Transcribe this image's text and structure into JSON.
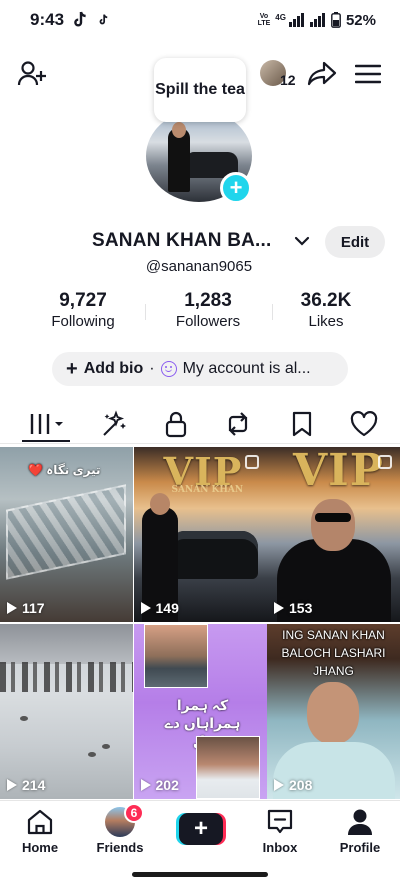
{
  "status_bar": {
    "time": "9:43",
    "volte_label": "Vo\nLTE",
    "network": "4G",
    "battery": "52%"
  },
  "header": {
    "add_friend_icon": "add-person-icon",
    "visitor_count": "12",
    "share_icon": "share-arrow-icon",
    "menu_icon": "hamburger-menu-icon"
  },
  "profile": {
    "note_bubble": "Spill the tea",
    "display_name": "SANAN KHAN BA...",
    "handle": "@sananan9065",
    "edit_label": "Edit",
    "add_avatar_plus": "+"
  },
  "stats": [
    {
      "value": "9,727",
      "label": "Following"
    },
    {
      "value": "1,283",
      "label": "Followers"
    },
    {
      "value": "36.2K",
      "label": "Likes"
    }
  ],
  "bio": {
    "add_bio_label": "Add bio",
    "separator": "·",
    "account_label": "My account is al..."
  },
  "tabs": [
    {
      "name": "videos",
      "icon": "grid-bars-icon",
      "active": true
    },
    {
      "name": "sparkle",
      "icon": "sparkle-magic-icon"
    },
    {
      "name": "private",
      "icon": "lock-icon"
    },
    {
      "name": "reposts",
      "icon": "repost-icon"
    },
    {
      "name": "favorites",
      "icon": "bookmark-icon"
    },
    {
      "name": "liked",
      "icon": "heart-icon"
    }
  ],
  "videos": [
    {
      "views": "117",
      "caption": "تیری نگاہ ❤️"
    },
    {
      "views": "149",
      "overlay_title": "VIP",
      "overlay_sub": "SANAN KHAN"
    },
    {
      "views": "153",
      "overlay_title": "VIP"
    },
    {
      "views": "214"
    },
    {
      "views": "202",
      "caption": "کہ ہمرا ہمراہاں دے دل"
    },
    {
      "views": "208",
      "caption": "ING SANAN KHAN BALOCH LASHARI JHANG"
    }
  ],
  "bottom_nav": {
    "home": "Home",
    "friends": "Friends",
    "friends_badge": "6",
    "create": "+",
    "inbox": "Inbox",
    "profile": "Profile"
  },
  "colors": {
    "accent_cyan": "#20d5ec",
    "accent_red": "#fe2c55",
    "text": "#161823"
  }
}
